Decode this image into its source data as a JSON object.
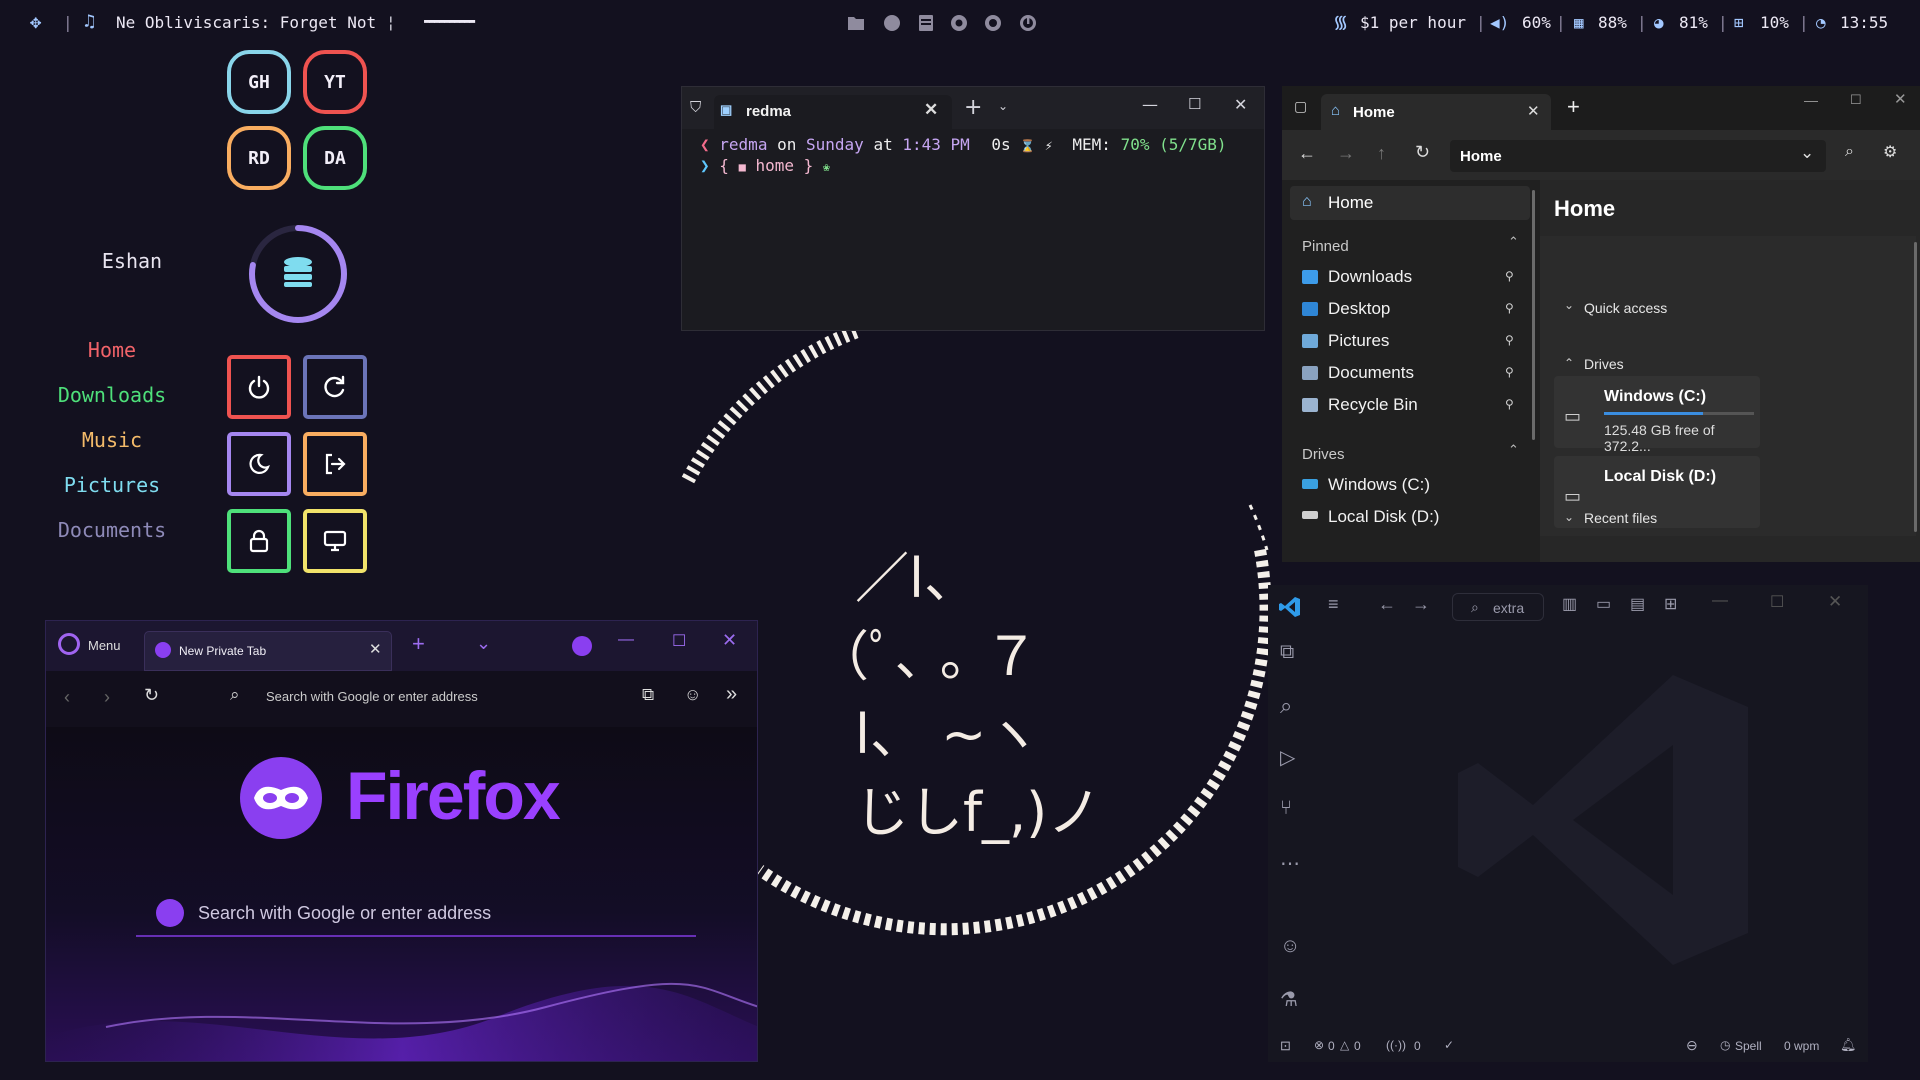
{
  "topbar": {
    "workspace_icon": "grid-icon",
    "music_icon": "music-note-icon",
    "now_playing": "Ne Obliviscaris: Forget Not",
    "playing_indicator": "¦",
    "progress_bar": "▬▬▬▬▬▬▬▬▬▬",
    "center_icons": [
      "folder-icon",
      "globe-icon",
      "document-icon",
      "record-icon",
      "refresh-icon",
      "power-icon"
    ],
    "wifi_text": "$1 per hour",
    "volume_text": "60%",
    "memory_text": "88%",
    "disk_text": "81%",
    "cpu_text": "10%",
    "clock_text": "13:55",
    "separator": "|"
  },
  "sidebar": {
    "tiles": [
      {
        "label": "GH",
        "color": "#89d5ea"
      },
      {
        "label": "YT",
        "color": "#ef5350"
      },
      {
        "label": "RD",
        "color": "#f9ad60"
      },
      {
        "label": "DA",
        "color": "#4ee07a"
      }
    ],
    "username": "Eshan",
    "disk_ring_level": 0.78,
    "nav": [
      {
        "label": "Home",
        "color": "#f16369"
      },
      {
        "label": "Downloads",
        "color": "#4ee07a"
      },
      {
        "label": "Music",
        "color": "#f4bb6a"
      },
      {
        "label": "Pictures",
        "color": "#7fdcef"
      },
      {
        "label": "Documents",
        "color": "#8e8ab8"
      }
    ],
    "session_buttons": [
      {
        "name": "power-icon",
        "color": "#ef5350"
      },
      {
        "name": "restart-icon",
        "color": "#6b74b8"
      },
      {
        "name": "moon-icon",
        "color": "#a587f0"
      },
      {
        "name": "logout-icon",
        "color": "#f9ad60"
      },
      {
        "name": "lock-icon",
        "color": "#4ee07a"
      },
      {
        "name": "monitor-icon",
        "color": "#f1e36a"
      }
    ]
  },
  "terminal": {
    "tab_title": "redma",
    "line1": {
      "user": "redma",
      "on": "on",
      "day": "Sunday",
      "at": "at",
      "time": "1:43 PM",
      "duration": "0s",
      "mem_label": "MEM:",
      "mem_value": "70% (5/7GB)"
    },
    "line2": {
      "open": "{",
      "dir": "home",
      "close": "}"
    }
  },
  "explorer": {
    "tab_title": "Home",
    "address": "Home",
    "nav_home": "Home",
    "pinned_label": "Pinned",
    "pinned": [
      {
        "label": "Downloads",
        "icon": "download-icon",
        "color": "#3d9be9"
      },
      {
        "label": "Desktop",
        "icon": "desktop-icon",
        "color": "#2f86d6"
      },
      {
        "label": "Pictures",
        "icon": "pictures-icon",
        "color": "#6fa9d8"
      },
      {
        "label": "Documents",
        "icon": "documents-icon",
        "color": "#8aa2c0"
      },
      {
        "label": "Recycle Bin",
        "icon": "recycle-bin-icon",
        "color": "#9bb4d0"
      }
    ],
    "drives_label": "Drives",
    "drives_nav": [
      "Windows (C:)",
      "Local Disk (D:)"
    ],
    "content_title": "Home",
    "quick_access": "Quick access",
    "drives_section": "Drives",
    "drive_c": {
      "name": "Windows (C:)",
      "free": "125.48 GB free of 372.2...",
      "used_fraction": 0.66
    },
    "drive_d": {
      "name": "Local Disk (D:)"
    },
    "recent_files": "Recent files"
  },
  "firefox": {
    "menu_label": "Menu",
    "tab_title": "New Private Tab",
    "address_placeholder": "Search with Google or enter address",
    "brand": "Firefox",
    "content_search": "Search with Google or enter address"
  },
  "vscode": {
    "search_text": "extra",
    "status": {
      "errors": "0",
      "warnings": "0",
      "ports": "0",
      "spell": "Spell",
      "wpm": "0 wpm"
    }
  },
  "kaomoji": {
    "line1": "／l、",
    "line2": "（ﾟ､ ｡ ７",
    "line3": "l、 ~ヽ",
    "line4": "じしf_,)ノ"
  }
}
